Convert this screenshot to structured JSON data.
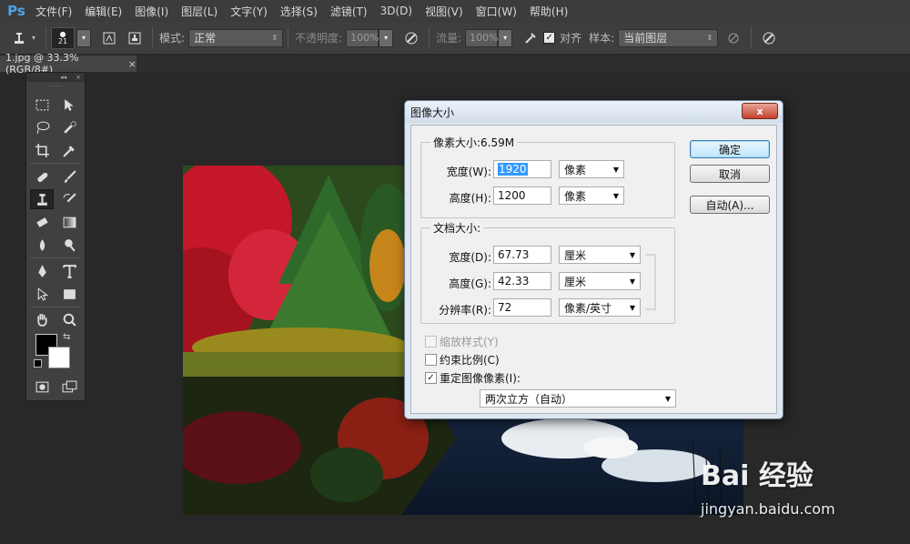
{
  "app": {
    "logo": "Ps"
  },
  "menu": [
    "文件(F)",
    "编辑(E)",
    "图像(I)",
    "图层(L)",
    "文字(Y)",
    "选择(S)",
    "滤镜(T)",
    "3D(D)",
    "视图(V)",
    "窗口(W)",
    "帮助(H)"
  ],
  "options": {
    "brush_size": "21",
    "mode_label": "模式:",
    "mode_value": "正常",
    "opacity_label": "不透明度:",
    "opacity_value": "100%",
    "flow_label": "流量:",
    "flow_value": "100%",
    "align_label": "对齐",
    "align_checked": true,
    "sample_label": "样本:",
    "sample_value": "当前图层"
  },
  "document_tab": {
    "title": "1.jpg @ 33.3%(RGB/8#)",
    "close": "×"
  },
  "toolbox": {
    "collapse": "◂◂",
    "close": "×"
  },
  "dialog": {
    "title": "图像大小",
    "close": "x",
    "pixel_group": "像素大小:6.59M",
    "width_label": "宽度(W):",
    "width_value": "1920",
    "width_unit": "像素",
    "height_label": "高度(H):",
    "height_value": "1200",
    "height_unit": "像素",
    "doc_group": "文档大小:",
    "doc_width_label": "宽度(D):",
    "doc_width_value": "67.73",
    "doc_width_unit": "厘米",
    "doc_height_label": "高度(G):",
    "doc_height_value": "42.33",
    "doc_height_unit": "厘米",
    "resolution_label": "分辨率(R):",
    "resolution_value": "72",
    "resolution_unit": "像素/英寸",
    "scale_styles": "缩放样式(Y)",
    "constrain": "约束比例(C)",
    "resample": "重定图像像素(I):",
    "resample_method": "两次立方（自动）",
    "ok": "确定",
    "cancel": "取消",
    "auto": "自动(A)..."
  },
  "watermark": {
    "brand": "Bai 经验",
    "url": "jingyan.baidu.com"
  }
}
